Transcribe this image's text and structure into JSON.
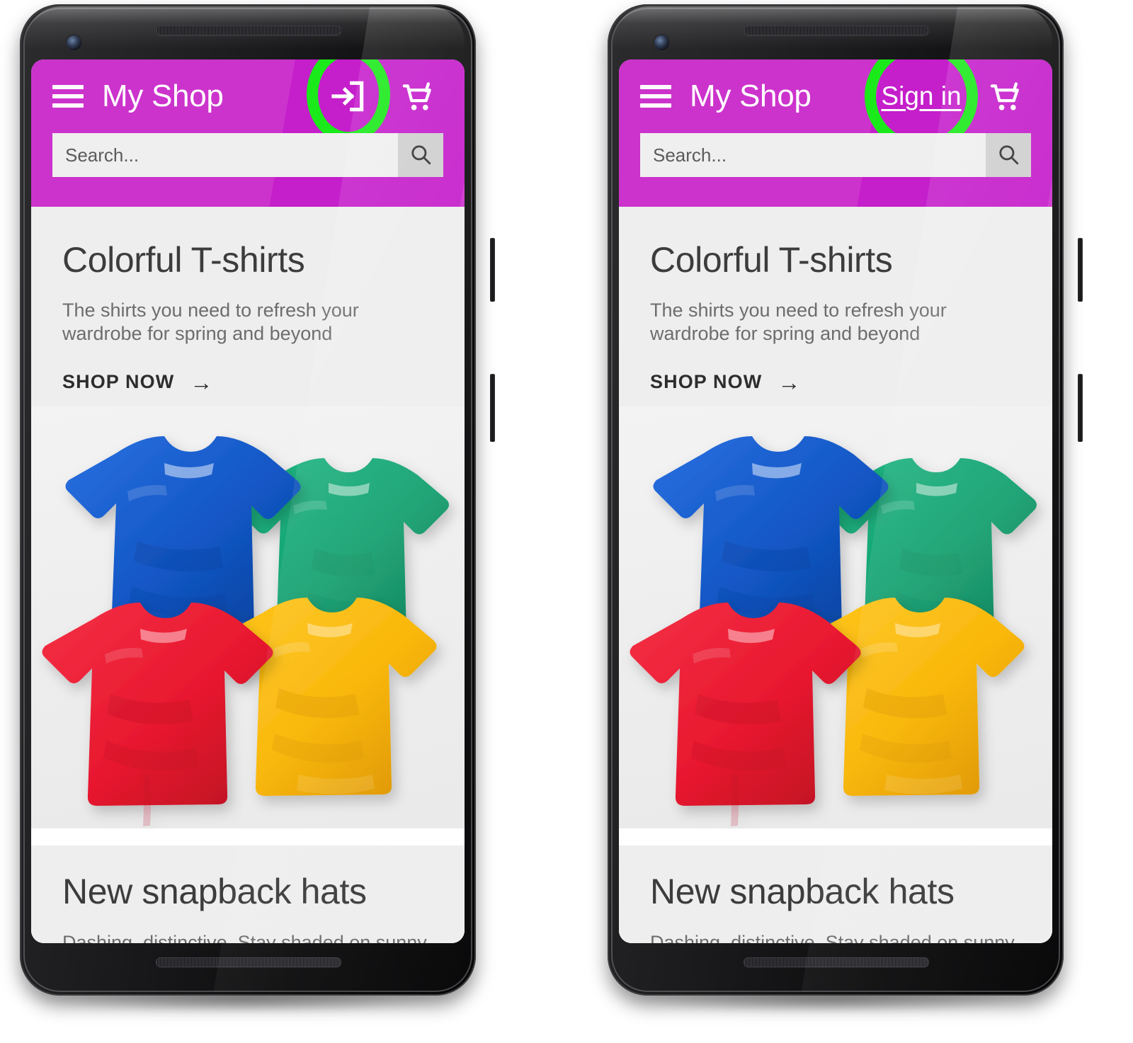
{
  "phones": [
    {
      "id": "phone-left",
      "variant": "icon",
      "appbar": {
        "brand": "My Shop",
        "menu_icon": "hamburger-menu-icon",
        "action_icon": "login-arrow-icon",
        "cart_icon": "shopping-cart-icon",
        "highlight_color": "#1aea1a",
        "bar_color": "#cc33cc",
        "bar_shade_color": "#c51ecb"
      },
      "search": {
        "placeholder": "Search...",
        "value": "",
        "button_icon": "search-magnifier-icon"
      },
      "hero": {
        "title": "Colorful T-shirts",
        "subtitle": "The shirts you need to refresh your wardrobe for spring and beyond",
        "cta_label": "SHOP NOW",
        "cta_arrow": "→",
        "image_alt": "four-folded-tshirts"
      },
      "second_card": {
        "title": "New snapback hats",
        "subtitle_clipped": "Dashing, distinctive. Stay shaded on sunny"
      }
    },
    {
      "id": "phone-right",
      "variant": "text",
      "appbar": {
        "brand": "My Shop",
        "menu_icon": "hamburger-menu-icon",
        "action_label": "Sign in",
        "cart_icon": "shopping-cart-icon",
        "highlight_color": "#1aea1a",
        "bar_color": "#cc33cc",
        "bar_shade_color": "#c51ecb"
      },
      "search": {
        "placeholder": "Search...",
        "value": "",
        "button_icon": "search-magnifier-icon"
      },
      "hero": {
        "title": "Colorful T-shirts",
        "subtitle": "The shirts you need to refresh your wardrobe for spring and beyond",
        "cta_label": "SHOP NOW",
        "cta_arrow": "→",
        "image_alt": "four-folded-tshirts"
      },
      "second_card": {
        "title": "New snapback hats",
        "subtitle_clipped": "Dashing, distinctive. Stay shaded on sunny"
      }
    }
  ],
  "tshirt_colors": {
    "blue": "#1256c4",
    "green": "#14a070",
    "red": "#e8182f",
    "yellow": "#f9b400"
  }
}
